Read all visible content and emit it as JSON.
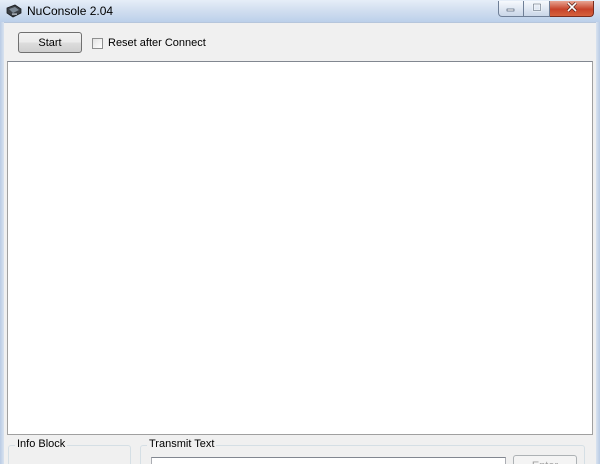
{
  "window": {
    "title": "NuConsole 2.04",
    "icon": "app-icon",
    "caption_buttons": [
      "minimize-icon",
      "maximize-icon",
      "close-icon"
    ]
  },
  "toolbar": {
    "start_label": "Start",
    "reset_after_connect_label": "Reset after Connect",
    "reset_after_connect_checked": false
  },
  "output": {
    "text": ""
  },
  "info_block": {
    "label": "Info Block"
  },
  "transmit": {
    "label": "Transmit Text",
    "value": "",
    "enter_label": "Enter",
    "enter_enabled": false
  },
  "colors": {
    "titlebar": "#d2dff0",
    "close_button": "#c7432a",
    "client_bg": "#f0f0f0"
  }
}
